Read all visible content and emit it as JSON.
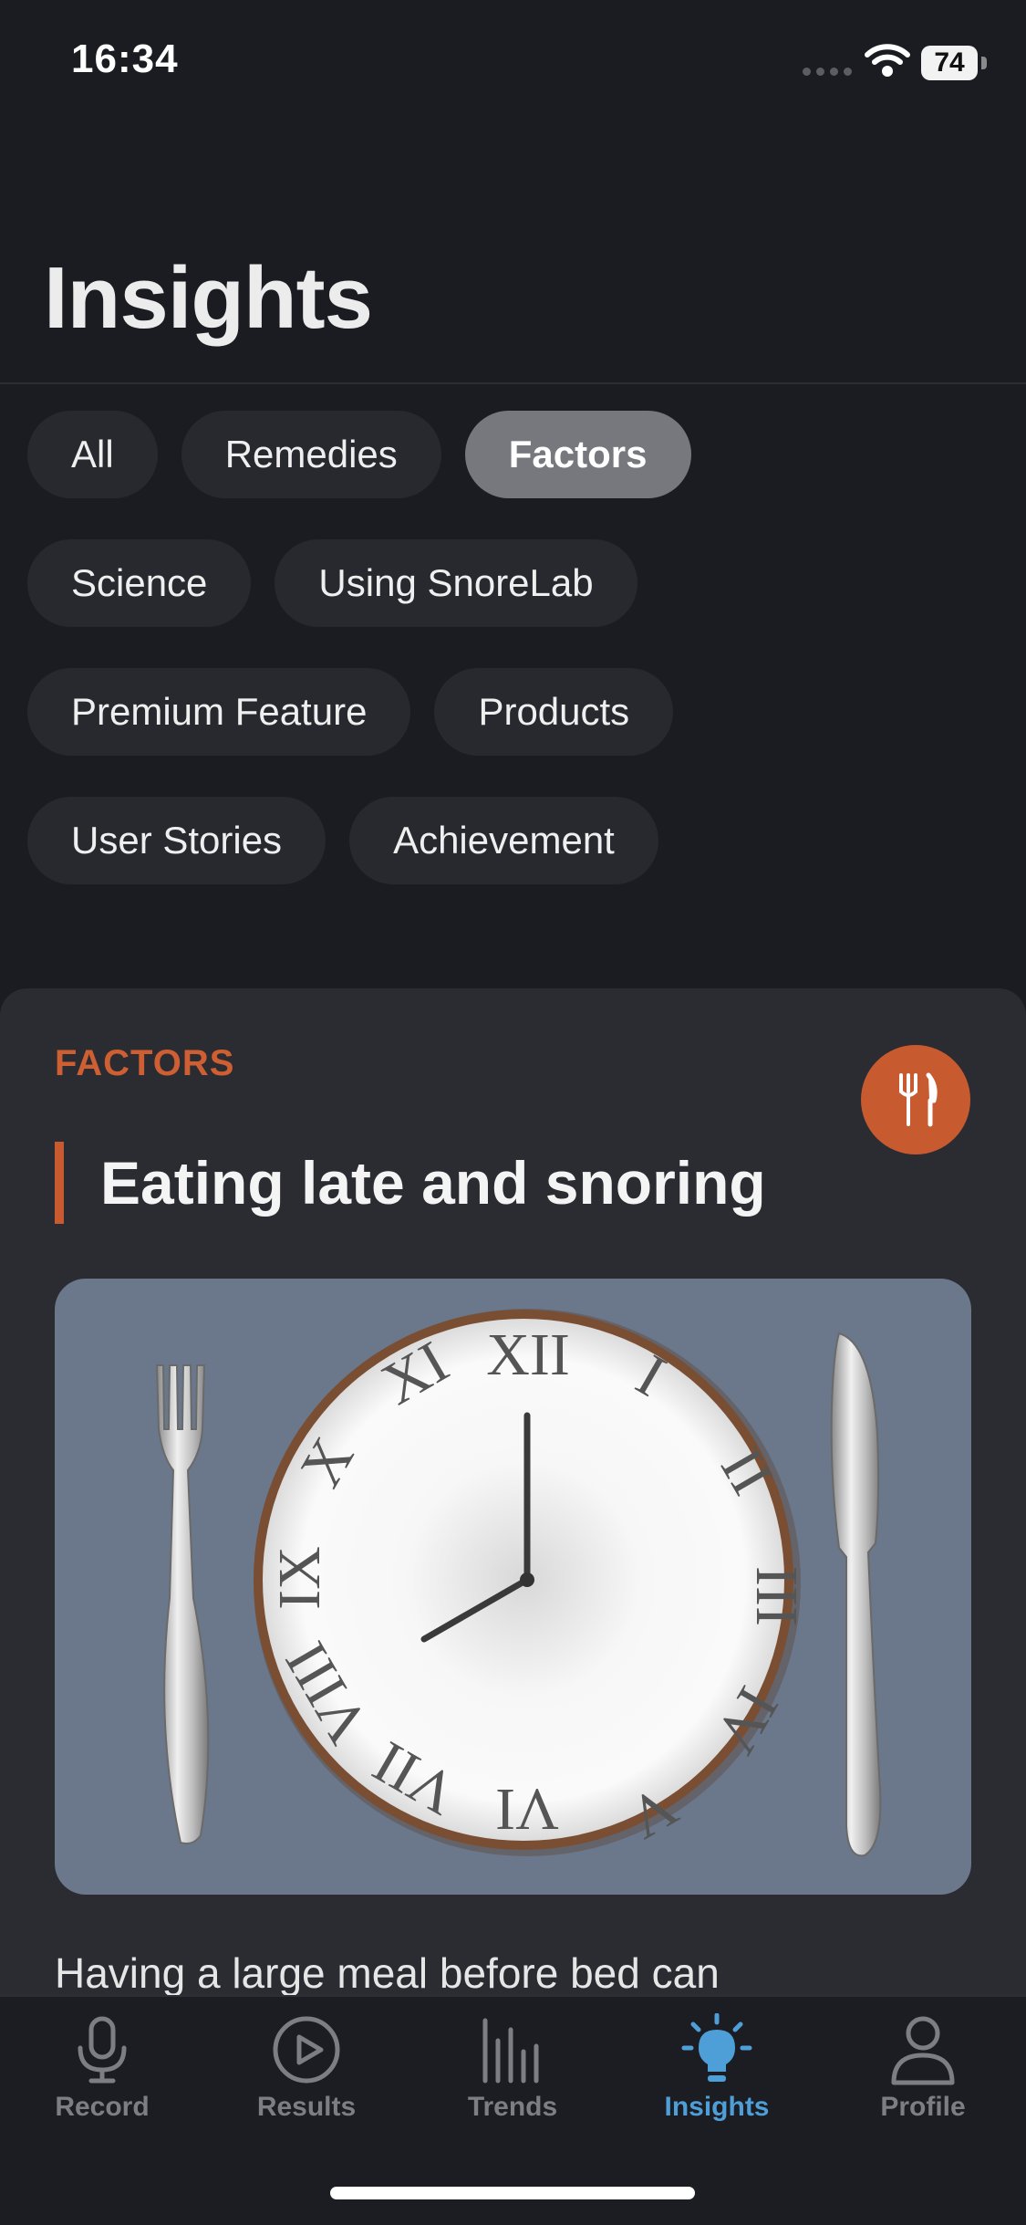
{
  "status_bar": {
    "time": "16:34",
    "battery": "74"
  },
  "page": {
    "title": "Insights"
  },
  "filters": {
    "rows": [
      [
        {
          "label": "All"
        },
        {
          "label": "Remedies"
        },
        {
          "label": "Factors",
          "active": true
        }
      ],
      [
        {
          "label": "Science"
        },
        {
          "label": "Using SnoreLab"
        }
      ],
      [
        {
          "label": "Premium Feature"
        },
        {
          "label": "Products"
        }
      ],
      [
        {
          "label": "User Stories"
        },
        {
          "label": "Achievement"
        }
      ]
    ]
  },
  "card": {
    "category": "FACTORS",
    "icon": "cutlery-icon",
    "title": "Eating late and snoring",
    "excerpt": "Having a large meal before bed can",
    "accent_color": "#c85a30"
  },
  "tab_bar": {
    "items": [
      {
        "label": "Record",
        "icon": "microphone-icon"
      },
      {
        "label": "Results",
        "icon": "play-circle-icon"
      },
      {
        "label": "Trends",
        "icon": "bar-chart-icon"
      },
      {
        "label": "Insights",
        "icon": "lightbulb-icon",
        "active": true
      },
      {
        "label": "Profile",
        "icon": "person-icon"
      }
    ],
    "active_color": "#4e9fd8"
  }
}
